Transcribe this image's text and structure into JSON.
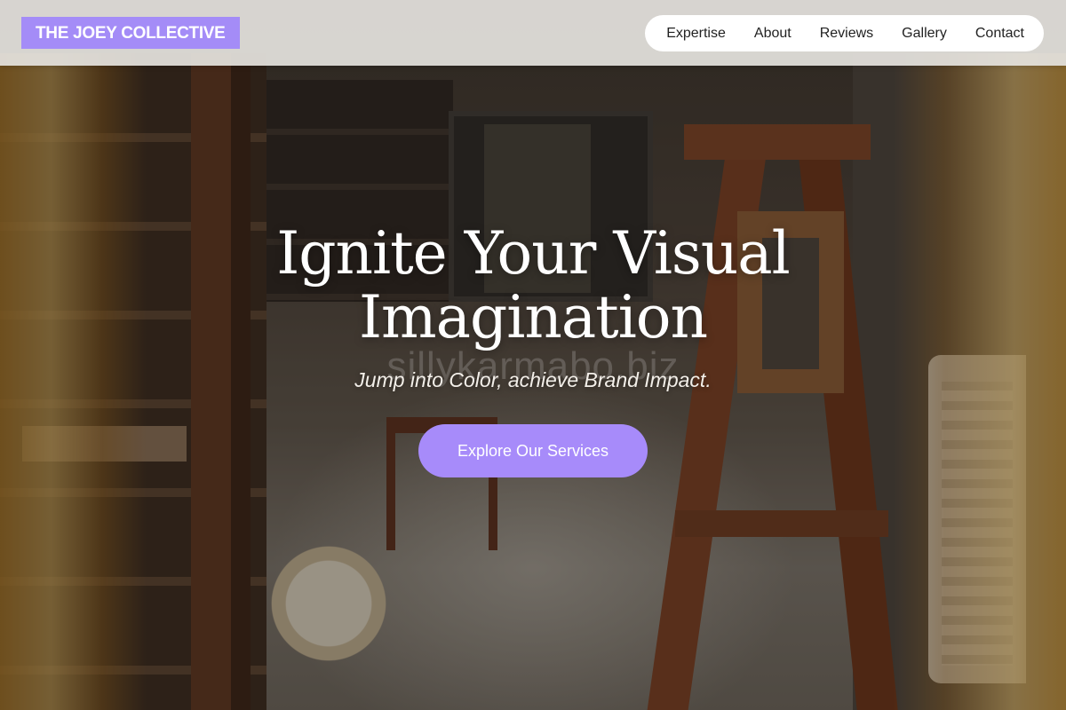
{
  "brand": {
    "name": "THE JOEY COLLECTIVE",
    "accent": "#a48cf7"
  },
  "nav": {
    "items": [
      {
        "label": "Expertise"
      },
      {
        "label": "About"
      },
      {
        "label": "Reviews"
      },
      {
        "label": "Gallery"
      },
      {
        "label": "Contact"
      }
    ]
  },
  "hero": {
    "headline_line1": "Ignite Your Visual",
    "headline_line2": "Imagination",
    "subheadline": "Jump into Color, achieve Brand Impact.",
    "cta_label": "Explore Our Services",
    "cta_color": "#a78bfa"
  },
  "watermark": {
    "text": "sillykarmabo.biz"
  }
}
